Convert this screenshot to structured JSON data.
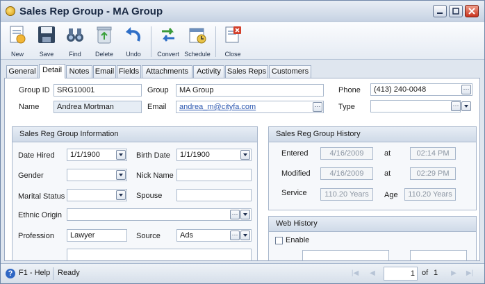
{
  "window": {
    "title": "Sales Rep Group - MA Group"
  },
  "toolbar": {
    "buttons": [
      {
        "label": "New",
        "icon": "new-icon"
      },
      {
        "label": "Save",
        "icon": "save-icon"
      },
      {
        "label": "Find",
        "icon": "binoculars-icon"
      },
      {
        "label": "Delete",
        "icon": "recycle-bin-icon"
      },
      {
        "label": "Undo",
        "icon": "undo-arrow-icon"
      },
      {
        "label": "Convert",
        "icon": "convert-arrows-icon"
      },
      {
        "label": "Schedule",
        "icon": "schedule-calendar-icon"
      },
      {
        "label": "Close",
        "icon": "close-doc-icon"
      }
    ]
  },
  "tabs": [
    {
      "label": "General"
    },
    {
      "label": "Detail"
    },
    {
      "label": "Notes"
    },
    {
      "label": "Email"
    },
    {
      "label": "Fields"
    },
    {
      "label": "Attachments"
    },
    {
      "label": "Activity"
    },
    {
      "label": "Sales Reps"
    },
    {
      "label": "Customers"
    }
  ],
  "active_tab": "Detail",
  "header": {
    "group_id_label": "Group ID",
    "group_id": "SRG10001",
    "group_label": "Group",
    "group": "MA Group",
    "phone_label": "Phone",
    "phone": "(413) 240-0048",
    "name_label": "Name",
    "name": "Andrea Mortman",
    "email_label": "Email",
    "email": "andrea_m@cityfa.com",
    "type_label": "Type",
    "type": ""
  },
  "info": {
    "title": "Sales Reg Group Information",
    "date_hired_label": "Date Hired",
    "date_hired": "1/1/1900",
    "birth_date_label": "Birth Date",
    "birth_date": "1/1/1900",
    "gender_label": "Gender",
    "gender": "",
    "nick_name_label": "Nick Name",
    "nick_name": "",
    "marital_status_label": "Marital Status",
    "marital_status": "",
    "spouse_label": "Spouse",
    "spouse": "",
    "ethnic_origin_label": "Ethnic Origin",
    "ethnic_origin": "",
    "profession_label": "Profession",
    "profession": "Lawyer",
    "source_label": "Source",
    "source": "Ads"
  },
  "history": {
    "title": "Sales Reg Group History",
    "entered_label": "Entered",
    "entered_date": "4/16/2009",
    "entered_time": "02:14 PM",
    "modified_label": "Modified",
    "modified_date": "4/16/2009",
    "modified_time": "02:29 PM",
    "at_label": "at",
    "service_label": "Service",
    "service": "110.20 Years",
    "age_label": "Age",
    "age": "110.20 Years"
  },
  "web_history": {
    "title": "Web History",
    "enable_label": "Enable",
    "enabled": false
  },
  "status": {
    "help": "F1 - Help",
    "state": "Ready",
    "page": "1",
    "of_label": "of",
    "total_pages": "1"
  }
}
